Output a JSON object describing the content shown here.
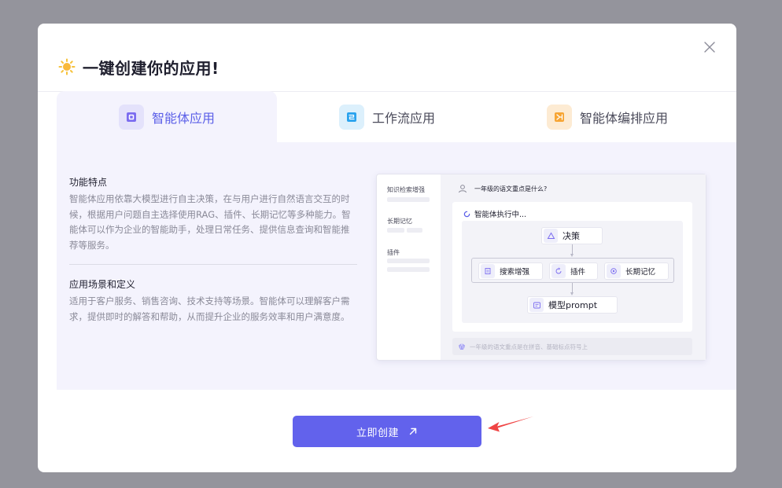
{
  "dialog": {
    "title": "一键创建你的应用!",
    "title_icon": "sun-icon",
    "close_icon": "close-icon"
  },
  "tabs": [
    {
      "label": "智能体应用",
      "icon": "agent-icon",
      "active": true,
      "accent": "#5b5fe8"
    },
    {
      "label": "工作流应用",
      "icon": "workflow-icon",
      "active": false,
      "accent": "#2aa3ee"
    },
    {
      "label": "智能体编排应用",
      "icon": "orchestration-icon",
      "active": false,
      "accent": "#f7a534"
    }
  ],
  "features": {
    "title": "功能特点",
    "text": "智能体应用依靠大模型进行自主决策，在与用户进行自然语言交互的时候，根据用户问题自主选择使用RAG、插件、长期记忆等多种能力。智能体可以作为企业的智能助手，处理日常任务、提供信息查询和智能推荐等服务。"
  },
  "scenarios": {
    "title": "应用场景和定义",
    "text": "适用于客户服务、销售咨询、技术支持等场景。智能体可以理解客户需求，提供即时的解答和帮助，从而提升企业的服务效率和用户满意度。"
  },
  "preview": {
    "sidebar": [
      "知识检索增强",
      "长期记忆",
      "插件"
    ],
    "question": "一年级的语文重点是什么?",
    "executing": "智能体执行中...",
    "nodes": {
      "decision": "决策",
      "search": "搜索增强",
      "plugin": "插件",
      "memory": "长期记忆",
      "model": "模型prompt"
    },
    "input_placeholder": "一年级的语文重点是在拼音、基础标点符号上"
  },
  "actions": {
    "create_label": "立即创建",
    "primary_color": "#6262ec"
  }
}
